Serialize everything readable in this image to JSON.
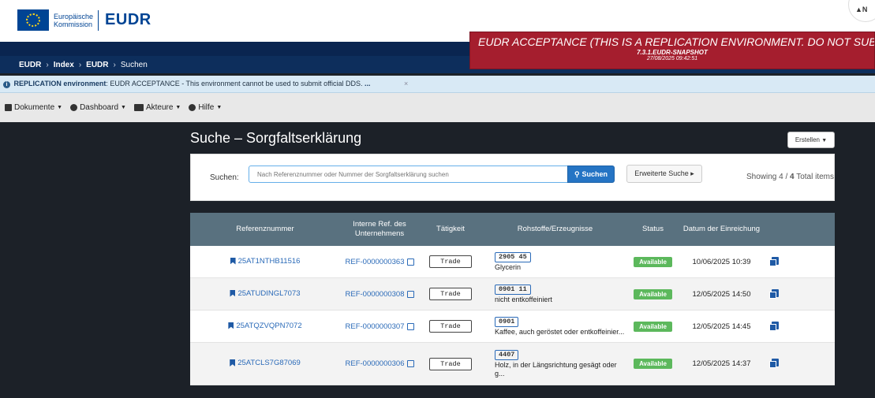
{
  "header": {
    "logo_line1": "Europäische",
    "logo_line2": "Kommission",
    "app_name": "EUDR",
    "notification_text": "N"
  },
  "breadcrumb": {
    "items": [
      "EUDR",
      "Index",
      "EUDR",
      "Suchen"
    ],
    "separator": "›"
  },
  "environment_banner": {
    "title": "EUDR ACCEPTANCE (THIS IS A REPLICATION ENVIRONMENT. DO NOT SUBMI",
    "version": "7.3.1.EUDR-SNAPSHOT",
    "date": "27/08/2025 09:42:51",
    "color": "#a51e2e"
  },
  "info_bar": {
    "label": "REPLICATION environment",
    "message": ": EUDR ACCEPTANCE - This environment cannot be used to submit official DDS.",
    "ellipsis": "...",
    "close": "×"
  },
  "menu": {
    "items": [
      {
        "label": "Dokumente",
        "icon": "document-icon"
      },
      {
        "label": "Dashboard",
        "icon": "dashboard-icon"
      },
      {
        "label": "Akteure",
        "icon": "id-card-icon"
      },
      {
        "label": "Hilfe",
        "icon": "help-icon"
      }
    ]
  },
  "page": {
    "title": "Suche – Sorgfaltserklärung",
    "create_label": "Erstellen"
  },
  "search": {
    "label": "Suchen:",
    "placeholder": "Nach Referenznummer oder Nummer der Sorgfaltserklärung suchen",
    "button_label": "Suchen",
    "advanced_label": "Erweiterte Suche",
    "showing_prefix": "Showing",
    "showing_count": "4",
    "showing_sep": "/",
    "showing_total": "4",
    "showing_suffix": "Total items"
  },
  "table": {
    "headers": [
      "Referenznummer",
      "Interne Ref. des Unternehmens",
      "Tätigkeit",
      "Rohstoffe/Erzeugnisse",
      "Status",
      "Datum der Einreichung",
      ""
    ],
    "rows": [
      {
        "ref": "25AT1NTHB11516",
        "internal_ref": "REF-0000000363",
        "activity": "Trade",
        "code": "2905 45",
        "product": "Glycerin",
        "status": "Available",
        "date": "10/06/2025 10:39"
      },
      {
        "ref": "25ATUDINGL7073",
        "internal_ref": "REF-0000000308",
        "activity": "Trade",
        "code": "0901 11",
        "product": "nicht entkoffeiniert",
        "status": "Available",
        "date": "12/05/2025 14:50"
      },
      {
        "ref": "25ATQZVQPN7072",
        "internal_ref": "REF-0000000307",
        "activity": "Trade",
        "code": "0901",
        "product": "Kaffee, auch geröstet oder entkoffeinier...",
        "status": "Available",
        "date": "12/05/2025 14:45"
      },
      {
        "ref": "25ATCLS7G87069",
        "internal_ref": "REF-0000000306",
        "activity": "Trade",
        "code": "4407",
        "product": "Holz, in der Längsrichtung gesägt oder g...",
        "status": "Available",
        "date": "12/05/2025 14:37"
      }
    ]
  },
  "colors": {
    "header_blue": "#0d2e5c",
    "table_header": "#59717f",
    "status_green": "#5cb85c",
    "link_blue": "#2a6ab8"
  }
}
